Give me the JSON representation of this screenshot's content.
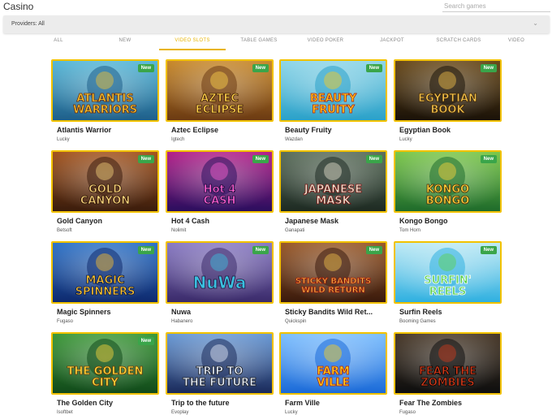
{
  "header": {
    "title": "Casino",
    "search_placeholder": "Search games"
  },
  "providers": {
    "label": "Providers: All"
  },
  "tabs": [
    {
      "label": "ALL",
      "active": false
    },
    {
      "label": "NEW",
      "active": false
    },
    {
      "label": "VIDEO SLOTS",
      "active": true
    },
    {
      "label": "TABLE GAMES",
      "active": false
    },
    {
      "label": "VIDEO POKER",
      "active": false
    },
    {
      "label": "JACKPOT",
      "active": false
    },
    {
      "label": "SCRATCH CARDS",
      "active": false
    },
    {
      "label": "VIDEO",
      "active": false
    }
  ],
  "badge_label": "New",
  "colors": {
    "accent": "#e8b400",
    "badge": "#3aa54a",
    "card_border": "#f2c200"
  },
  "games": [
    {
      "title": "Atlantis Warrior",
      "provider": "Lucky",
      "is_new": true,
      "art_text": "ATLANTIS WARRIORS"
    },
    {
      "title": "Aztec Eclipse",
      "provider": "Igtech",
      "is_new": true,
      "art_text": "AZTEC ECLIPSE"
    },
    {
      "title": "Beauty Fruity",
      "provider": "Wazdan",
      "is_new": true,
      "art_text": "BEAUTY FRUITY"
    },
    {
      "title": "Egyptian Book",
      "provider": "Lucky",
      "is_new": true,
      "art_text": "EGYPTIAN BOOK"
    },
    {
      "title": "Gold Canyon",
      "provider": "Betsoft",
      "is_new": true,
      "art_text": "GOLD CANYON"
    },
    {
      "title": "Hot 4 Cash",
      "provider": "Nolimit",
      "is_new": true,
      "art_text": "Hot 4 CASH"
    },
    {
      "title": "Japanese Mask",
      "provider": "Ganapati",
      "is_new": true,
      "art_text": "JAPANESE MASK"
    },
    {
      "title": "Kongo Bongo",
      "provider": "Tom Horn",
      "is_new": true,
      "art_text": "KONGO BONGO"
    },
    {
      "title": "Magic Spinners",
      "provider": "Fugaso",
      "is_new": true,
      "art_text": "MAGIC SPINNERS"
    },
    {
      "title": "Nuwa",
      "provider": "Habanero",
      "is_new": true,
      "art_text": "NuWa"
    },
    {
      "title": "Sticky Bandits Wild Ret...",
      "provider": "Quickspin",
      "is_new": true,
      "art_text": "STICKY BANDITS WILD RETURN"
    },
    {
      "title": "Surfin Reels",
      "provider": "Booming Games",
      "is_new": true,
      "art_text": "SURFIN' REELS"
    },
    {
      "title": "The Golden City",
      "provider": "Isoftbet",
      "is_new": true,
      "art_text": "THE GOLDEN CITY"
    },
    {
      "title": "Trip to the future",
      "provider": "Evoplay",
      "is_new": false,
      "art_text": "TRIP TO THE FUTURE"
    },
    {
      "title": "Farm Ville",
      "provider": "Lucky",
      "is_new": false,
      "art_text": "FARM VILLE"
    },
    {
      "title": "Fear The Zombies",
      "provider": "Fugaso",
      "is_new": false,
      "art_text": "FEAR THE ZOMBIES"
    }
  ]
}
